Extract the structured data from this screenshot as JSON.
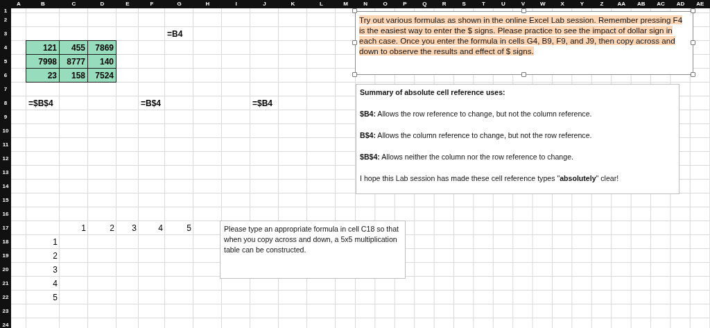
{
  "sheet": {
    "columns": [
      "A",
      "B",
      "C",
      "D",
      "E",
      "F",
      "G",
      "H",
      "I",
      "J",
      "K",
      "L",
      "M",
      "N",
      "O",
      "P",
      "Q",
      "R",
      "S",
      "T",
      "U",
      "V",
      "W",
      "X",
      "Y",
      "Z",
      "AA",
      "AB",
      "AC",
      "AD",
      "AE"
    ],
    "rows": [
      "1",
      "2",
      "3",
      "4",
      "5",
      "6",
      "7",
      "8",
      "9",
      "10",
      "11",
      "12",
      "13",
      "14",
      "15",
      "16",
      "17",
      "18",
      "19",
      "20",
      "21",
      "22",
      "23",
      "24"
    ],
    "cells": [
      {
        "text": "=B4",
        "kind": "text",
        "bold": true,
        "highlighted": false
      },
      {
        "text": "121",
        "kind": "number",
        "bold": true,
        "highlighted": true
      },
      {
        "text": "455",
        "kind": "number",
        "bold": true,
        "highlighted": true
      },
      {
        "text": "7869",
        "kind": "number",
        "bold": true,
        "highlighted": true
      },
      {
        "text": "7998",
        "kind": "number",
        "bold": true,
        "highlighted": true
      },
      {
        "text": "8777",
        "kind": "number",
        "bold": true,
        "highlighted": true
      },
      {
        "text": "140",
        "kind": "number",
        "bold": true,
        "highlighted": true
      },
      {
        "text": "23",
        "kind": "number",
        "bold": true,
        "highlighted": true
      },
      {
        "text": "158",
        "kind": "number",
        "bold": true,
        "highlighted": true
      },
      {
        "text": "7524",
        "kind": "number",
        "bold": true,
        "highlighted": true
      },
      {
        "text": "=$B$4",
        "kind": "text",
        "bold": true,
        "highlighted": false
      },
      {
        "text": "=B$4",
        "kind": "text",
        "bold": true,
        "highlighted": false
      },
      {
        "text": "=$B4",
        "kind": "text",
        "bold": true,
        "highlighted": false
      },
      {
        "text": "1",
        "kind": "number",
        "bold": false,
        "highlighted": false
      },
      {
        "text": "2",
        "kind": "number",
        "bold": false,
        "highlighted": false
      },
      {
        "text": "3",
        "kind": "number",
        "bold": false,
        "highlighted": false
      },
      {
        "text": "4",
        "kind": "number",
        "bold": false,
        "highlighted": false
      },
      {
        "text": "5",
        "kind": "number",
        "bold": false,
        "highlighted": false
      },
      {
        "text": "1",
        "kind": "number",
        "bold": false,
        "highlighted": false
      },
      {
        "text": "2",
        "kind": "number",
        "bold": false,
        "highlighted": false
      },
      {
        "text": "3",
        "kind": "number",
        "bold": false,
        "highlighted": false
      },
      {
        "text": "4",
        "kind": "number",
        "bold": false,
        "highlighted": false
      },
      {
        "text": "5",
        "kind": "number",
        "bold": false,
        "highlighted": false
      }
    ]
  },
  "text_boxes": [
    {
      "selected": true,
      "highlighted": true,
      "paragraphs": [
        "Try out various formulas as shown in the online Excel Lab session. Remember pressing F4 is the easiest way to enter the $ signs. Please practice to see the impact of dollar sign in each case. Once you enter the formula in cells G4, B9, F9, and J9, then copy across and down to observe the results and effect of $ signs."
      ]
    },
    {
      "selected": false,
      "highlighted": false,
      "paragraphs": [
        "**Summary of absolute cell reference uses:**",
        "**$B4:** Allows the row reference to change, but not the column reference.",
        "**B$4:** Allows the column reference to change, but not the row reference.",
        "**$B$4:** Allows neither the column nor the row reference to change.",
        "I hope this Lab session has made these cell reference types \"**absolutely**\" clear!"
      ]
    },
    {
      "selected": false,
      "highlighted": false,
      "paragraphs": [
        "Please type an appropriate formula in cell C18 so that when you copy across and down, a 5x5 multiplication table can be constructed."
      ]
    }
  ]
}
